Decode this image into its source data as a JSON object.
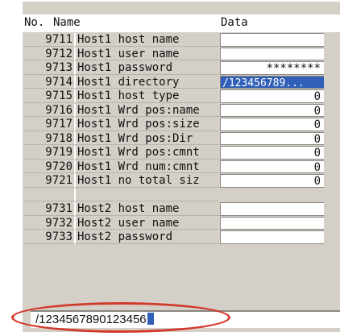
{
  "header": {
    "col_no": "No.",
    "col_name": "Name",
    "col_data": "Data"
  },
  "rows": [
    {
      "no": "9711",
      "name": "Host1 host name",
      "data": ""
    },
    {
      "no": "9712",
      "name": "Host1 user name",
      "data": ""
    },
    {
      "no": "9713",
      "name": "Host1 password",
      "data": "********"
    },
    {
      "no": "9714",
      "name": "Host1 directory",
      "data": "/123456789..."
    },
    {
      "no": "9715",
      "name": "Host1 host type",
      "data": "0"
    },
    {
      "no": "9716",
      "name": "Host1 Wrd pos:name",
      "data": "0"
    },
    {
      "no": "9717",
      "name": "Host1 Wrd pos:size",
      "data": "0"
    },
    {
      "no": "9718",
      "name": "Host1 Wrd pos:Dir",
      "data": "0"
    },
    {
      "no": "9719",
      "name": "Host1 Wrd pos:cmnt",
      "data": "0"
    },
    {
      "no": "9720",
      "name": "Host1 Wrd num:cmnt",
      "data": "0"
    },
    {
      "no": "9721",
      "name": "Host1 no total siz",
      "data": "0"
    },
    {
      "no": "",
      "name": "",
      "data": ""
    },
    {
      "no": "9731",
      "name": "Host2 host name",
      "data": ""
    },
    {
      "no": "9732",
      "name": "Host2 user name",
      "data": ""
    },
    {
      "no": "9733",
      "name": "Host2 password",
      "data": ""
    }
  ],
  "input": {
    "value": "/1234567890123456"
  },
  "colors": {
    "selection": "#2f5fb8",
    "panel": "#d4d0c8",
    "highlight_oval": "#d23a2c"
  }
}
